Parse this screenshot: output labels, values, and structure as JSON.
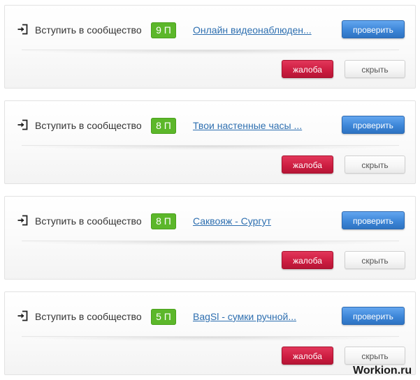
{
  "tasks": [
    {
      "action": "Вступить в сообщество",
      "points": "9 П",
      "target": "Онлайн видеонаблюден...",
      "check_label": "проверить",
      "report_label": "жалоба",
      "hide_label": "скрыть"
    },
    {
      "action": "Вступить в сообщество",
      "points": "8 П",
      "target": "Твои настенные часы ...",
      "check_label": "проверить",
      "report_label": "жалоба",
      "hide_label": "скрыть"
    },
    {
      "action": "Вступить в сообщество",
      "points": "8 П",
      "target": "Саквояж - Сургут",
      "check_label": "проверить",
      "report_label": "жалоба",
      "hide_label": "скрыть"
    },
    {
      "action": "Вступить в сообщество",
      "points": "5 П",
      "target": "BagSl - сумки ручной...",
      "check_label": "проверить",
      "report_label": "жалоба",
      "hide_label": "скрыть"
    }
  ],
  "watermark": "Workion.ru",
  "colors": {
    "badge_green": "#5cb72a",
    "check_blue": "#3d86d8",
    "report_red": "#cc1c40",
    "link_blue": "#2e6fb0"
  },
  "icons": {
    "action_icon": "enter-arrow-icon"
  }
}
